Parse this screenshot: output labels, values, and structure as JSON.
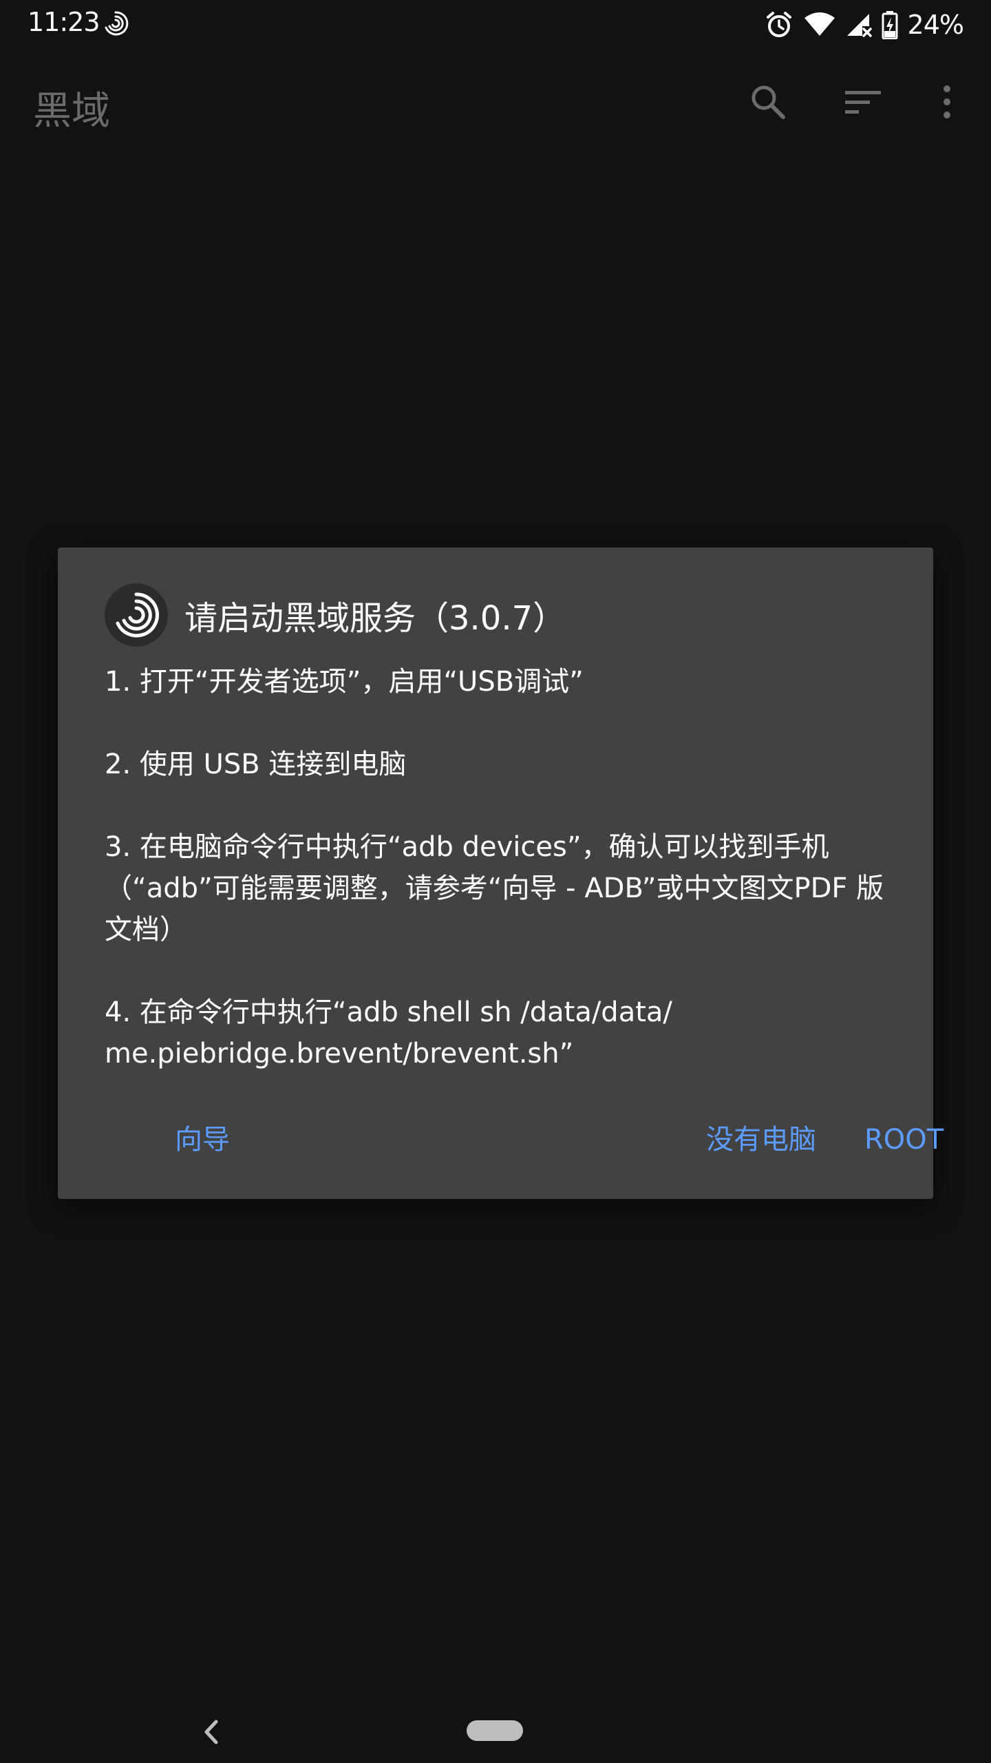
{
  "status_bar": {
    "time": "11:23",
    "battery_percent": "24%",
    "icons": [
      "brevent-app-icon",
      "alarm-icon",
      "wifi-icon",
      "cell-signal-icon",
      "battery-charging-icon"
    ]
  },
  "app_bar": {
    "title": "黑域",
    "actions": [
      "search-icon",
      "sort-icon",
      "more-vert-icon"
    ]
  },
  "dialog": {
    "title": "请启动黑域服务（3.0.7）",
    "steps": [
      "1. 打开“开发者选项”，启用“USB调试”",
      "2. 使用 USB 连接到电脑",
      "3. 在电脑命令行中执行“adb devices”，确认可以找到手机（“adb”可能需要调整，请参考“向导 - ADB”或中文图文PDF 版文档）",
      "4. 在命令行中执行“adb shell sh /data/data/\nme.piebridge.brevent/brevent.sh”"
    ],
    "buttons": {
      "guide": "向导",
      "no_pc": "没有电脑",
      "root": "ROOT"
    },
    "accent_color": "#5c9bff"
  },
  "nav_bar": {
    "icons": [
      "back-icon",
      "home-pill"
    ]
  },
  "colors": {
    "background": "#121212",
    "dialog_background": "#424242",
    "app_title": "#6b6b6b"
  }
}
